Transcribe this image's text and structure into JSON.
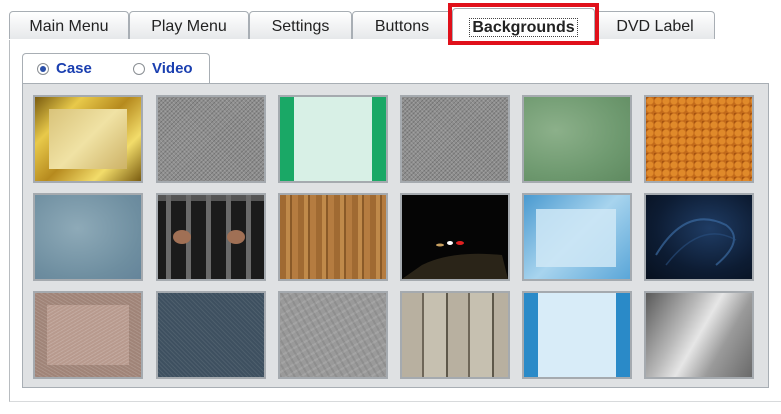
{
  "tabs": [
    {
      "label": "Main Menu",
      "active": false
    },
    {
      "label": "Play Menu",
      "active": false
    },
    {
      "label": "Settings",
      "active": false
    },
    {
      "label": "Buttons",
      "active": false
    },
    {
      "label": "Backgrounds",
      "active": true
    },
    {
      "label": "DVD Label",
      "active": false
    }
  ],
  "background_source": {
    "options": [
      {
        "label": "Case",
        "selected": true
      },
      {
        "label": "Video",
        "selected": false
      }
    ]
  },
  "thumbnails": [
    {
      "icon": "gold-frame-background"
    },
    {
      "icon": "gray-noise-background"
    },
    {
      "icon": "mint-green-stripes-background"
    },
    {
      "icon": "gray-noise-background"
    },
    {
      "icon": "green-clouds-background"
    },
    {
      "icon": "orange-pattern-background"
    },
    {
      "icon": "blue-gray-clouds-background"
    },
    {
      "icon": "prison-bars-background"
    },
    {
      "icon": "wood-planks-background"
    },
    {
      "icon": "night-road-background"
    },
    {
      "icon": "sky-blue-frame-background"
    },
    {
      "icon": "dark-blue-swirl-background"
    },
    {
      "icon": "rose-granite-frame-background"
    },
    {
      "icon": "denim-background"
    },
    {
      "icon": "stone-texture-background"
    },
    {
      "icon": "barn-wood-background"
    },
    {
      "icon": "light-blue-stripes-background"
    },
    {
      "icon": "brushed-metal-background"
    }
  ],
  "colors": {
    "highlight": "#e0101a",
    "radio_text": "#1a3fb0"
  }
}
